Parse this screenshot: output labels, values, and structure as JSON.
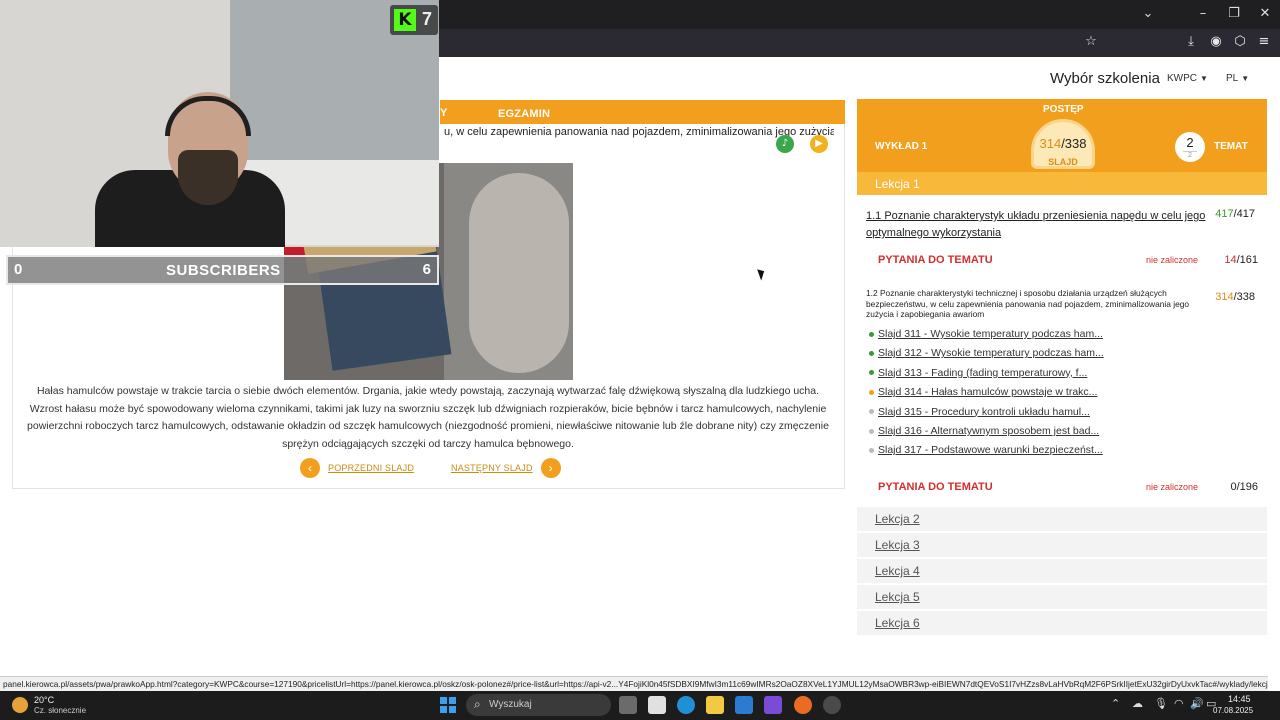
{
  "site": {
    "course_title": "Wybór szkolenia",
    "course_code": "KWPC",
    "language": "PL"
  },
  "tabs": {
    "prev_partial": "Y",
    "exam": "EGZAMIN"
  },
  "content": {
    "intro_text": "u, w celu zapewnienia panowania nad pojazdem, zminimalizowania jego zużycia i",
    "description": "Hałas hamulców powstaje w trakcie tarcia o siebie dwóch elementów. Drgania, jakie wtedy powstają, zaczynają wytwarzać falę dźwiękową słyszalną dla ludzkiego ucha. Wzrost hałasu może być spowodowany wieloma czynnikami, takimi jak luzy na sworzniu szczęk lub dźwigniach rozpieraków, bicie bębnów i tarcz hamulcowych, nachylenie powierzchni roboczych tarcz hamulcowych, odstawanie okładzin od szczęk hamulcowych (niezgodność promieni, niewłaściwe nitowanie lub źle dobrane nity) czy zmęczenie sprężyn odciągających szczęki od tarczy hamulca bębnowego.",
    "prev_slide": "POPRZEDNI SLAJD",
    "next_slide": "NASTĘPNY SLAJD"
  },
  "stream": {
    "kick_count": "7",
    "subs_left": "0",
    "subs_label": "SUBSCRIBERS",
    "subs_right": "6"
  },
  "sidebar": {
    "lecture": "WYKŁAD 1",
    "progress_label": "POSTĘP",
    "slide_current": "314",
    "slide_total": "/338",
    "slide_label": "SLAJD",
    "topic_num": "2",
    "topic_total": "2",
    "topic_label": "TEMAT",
    "lesson_active": "Lekcja 1",
    "topics": [
      {
        "title": "1.1 Poznanie charakterystyk układu przeniesienia napędu w celu jego optymalnego wykorzystania",
        "done": "417",
        "total": "/417"
      },
      {
        "title": "1.2 Poznanie charakterystyki technicznej i sposobu działania urządzeń służących bezpieczeństwu, w celu zapewnienia panowania nad pojazdem, zminimalizowania jego zużycia i zapobiegania awariom",
        "done": "314",
        "total": "/338"
      }
    ],
    "questions": [
      {
        "label": "PYTANIA DO TEMATU",
        "status": "nie zaliczone",
        "done": "14",
        "total": "/161"
      },
      {
        "label": "PYTANIA DO TEMATU",
        "status": "nie zaliczone",
        "done": "0",
        "total": "/196"
      }
    ],
    "slides": [
      {
        "text": "Slajd 311 - Wysokie temperatury podczas ham...",
        "state": "done"
      },
      {
        "text": "Slajd 312 - Wysokie temperatury podczas ham...",
        "state": "done"
      },
      {
        "text": "Slajd 313 - Fading (fading temperaturowy, f...",
        "state": "done"
      },
      {
        "text": "Slajd 314 - Hałas hamulców powstaje w trakc...",
        "state": "current"
      },
      {
        "text": "Slajd 315 - Procedury kontroli układu hamul...",
        "state": "todo"
      },
      {
        "text": "Slajd 316 - Alternatywnym sposobem jest bad...",
        "state": "todo"
      },
      {
        "text": "Slajd 317 - Podstawowe warunki bezpieczeńst...",
        "state": "todo"
      }
    ],
    "lessons_collapsed": [
      "Lekcja 2",
      "Lekcja 3",
      "Lekcja 4",
      "Lekcja 5",
      "Lekcja 6"
    ]
  },
  "status_url": "panel.kierowca.pl/assets/pwa/prawkoApp.html?category=KWPC&course=127190&pricelistUrl=https://panel.kierowca.pl/oskz/osk-polonez#/price-list&url=https://api-v2...Y4FojiKl0n45fSDBXI9MfwI3m11c69wIMRs2OaOZ8XVeL1YJMUL12yMsaOWBR3wp-eiBIEWN7dtQEVoS1I7vHZzs8vLaHVbRqM2F6PSrkIIjetExU32girDyUxvkTac#/wyklady/lekcja-124/234/84483",
  "taskbar": {
    "temp": "20°C",
    "condition": "Cz. słonecznie",
    "search": "Wyszukaj",
    "time": "14:45",
    "date": "07.08.2025"
  },
  "colors": {
    "accent": "#f29f1d",
    "accent_light": "#f8b83a",
    "done": "#3a9a33",
    "fail": "#d32f2f"
  }
}
